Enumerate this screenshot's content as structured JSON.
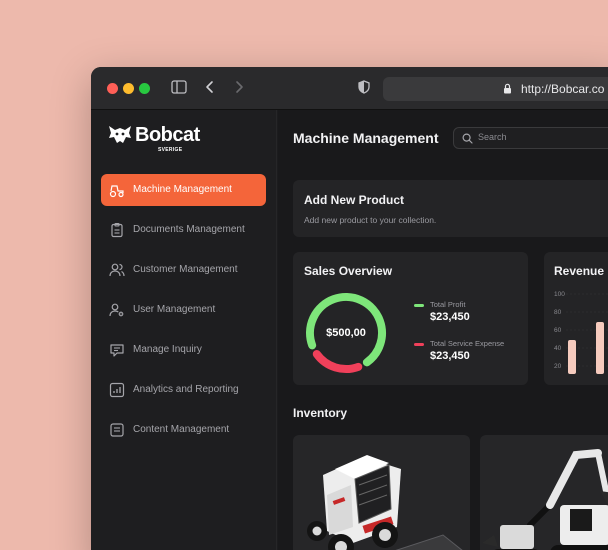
{
  "browser": {
    "url": "http://Bobcar.co"
  },
  "brand": {
    "name": "Bobcat",
    "sub": "SVERIGE",
    "accent": "#F4653A"
  },
  "sidebar": {
    "items": [
      {
        "label": "Machine Management",
        "icon": "tractor-icon",
        "active": true
      },
      {
        "label": "Documents Management",
        "icon": "clipboard-icon"
      },
      {
        "label": "Customer Management",
        "icon": "users-icon"
      },
      {
        "label": "User Management",
        "icon": "user-gear-icon"
      },
      {
        "label": "Manage Inquiry",
        "icon": "chat-icon"
      },
      {
        "label": "Analytics and Reporting",
        "icon": "chart-icon"
      },
      {
        "label": "Content Management",
        "icon": "document-icon"
      }
    ]
  },
  "header": {
    "title": "Machine Management",
    "search_placeholder": "Search"
  },
  "add_product": {
    "title": "Add New Product",
    "description": "Add new product to your collection."
  },
  "sales": {
    "title": "Sales Overview",
    "center_value": "$500,00",
    "legend": [
      {
        "label": "Total Profit",
        "value": "$23,450",
        "color": "#7EE67A"
      },
      {
        "label": "Total Service Expense",
        "value": "$23,450",
        "color": "#F0405A"
      }
    ],
    "profit_fraction": 0.75
  },
  "revenue": {
    "title": "Revenue U",
    "ticks": [
      "100",
      "80",
      "60",
      "40",
      "20"
    ]
  },
  "inventory": {
    "title": "Inventory"
  }
}
